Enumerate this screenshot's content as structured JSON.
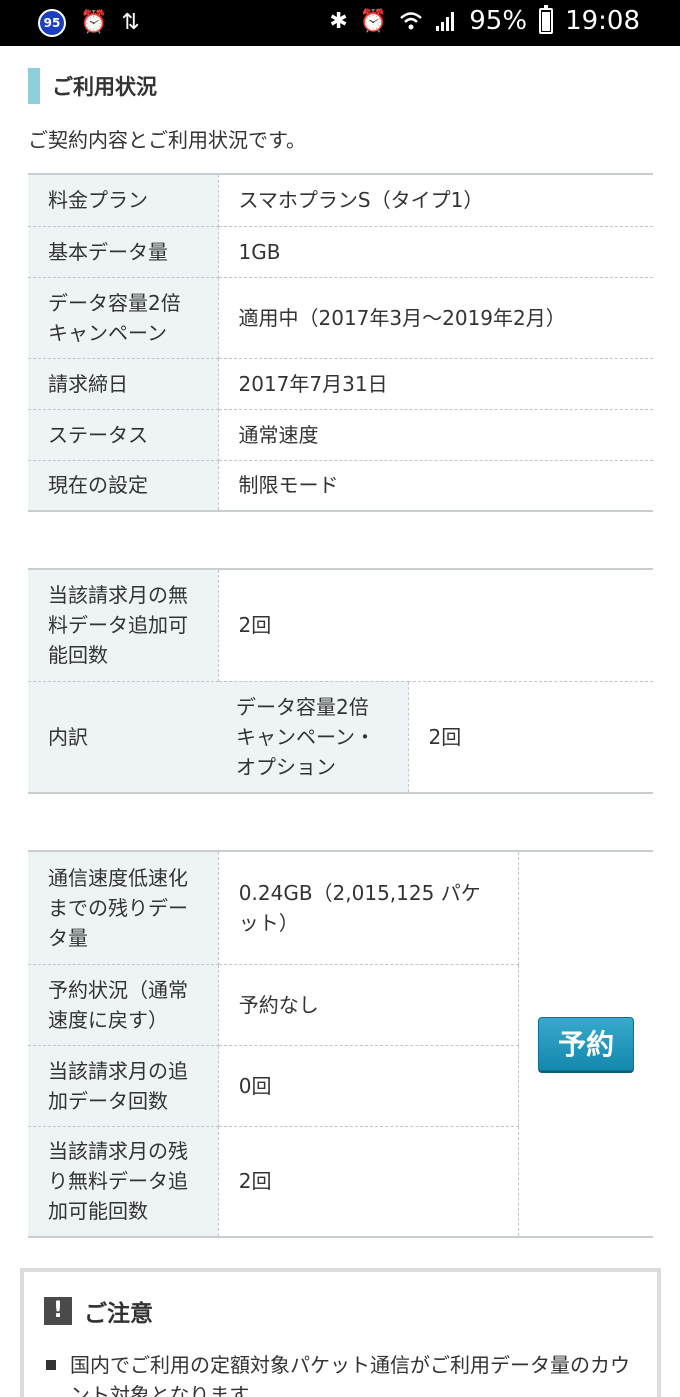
{
  "status_bar": {
    "badge": "95",
    "battery": "95%",
    "battery_level": 0.95,
    "time": "19:08"
  },
  "section_title": "ご利用状況",
  "intro": "ご契約内容とご利用状況です。",
  "contract": [
    {
      "label": "料金プラン",
      "value": "スマホプランS（タイプ1）"
    },
    {
      "label": "基本データ量",
      "value": "1GB"
    },
    {
      "label": "データ容量2倍キャンペーン",
      "value": "適用中（2017年3月～2019年2月）"
    },
    {
      "label": "請求締日",
      "value": "2017年7月31日"
    },
    {
      "label": "ステータス",
      "value": "通常速度"
    },
    {
      "label": "現在の設定",
      "value": "制限モード"
    }
  ],
  "free_data": {
    "label": "当該請求月の無料データ追加可能回数",
    "value": "2回",
    "breakdown_label": "内訳",
    "breakdown_item": "データ容量2倍キャンペーン・オプション",
    "breakdown_value": "2回"
  },
  "usage": [
    {
      "label": "通信速度低速化までの残りデータ量",
      "value": "0.24GB（2,015,125 パケット）"
    },
    {
      "label": "予約状況（通常速度に戻す）",
      "value": "予約なし"
    },
    {
      "label": "当該請求月の追加データ回数",
      "value": "0回"
    },
    {
      "label": "当該請求月の残り無料データ追加可能回数",
      "value": "2回"
    }
  ],
  "reserve_button": "予約",
  "notice": {
    "title": "ご注意",
    "items": [
      "国内でご利用の定額対象パケット通信がご利用データ量のカウント対象となります。"
    ]
  }
}
